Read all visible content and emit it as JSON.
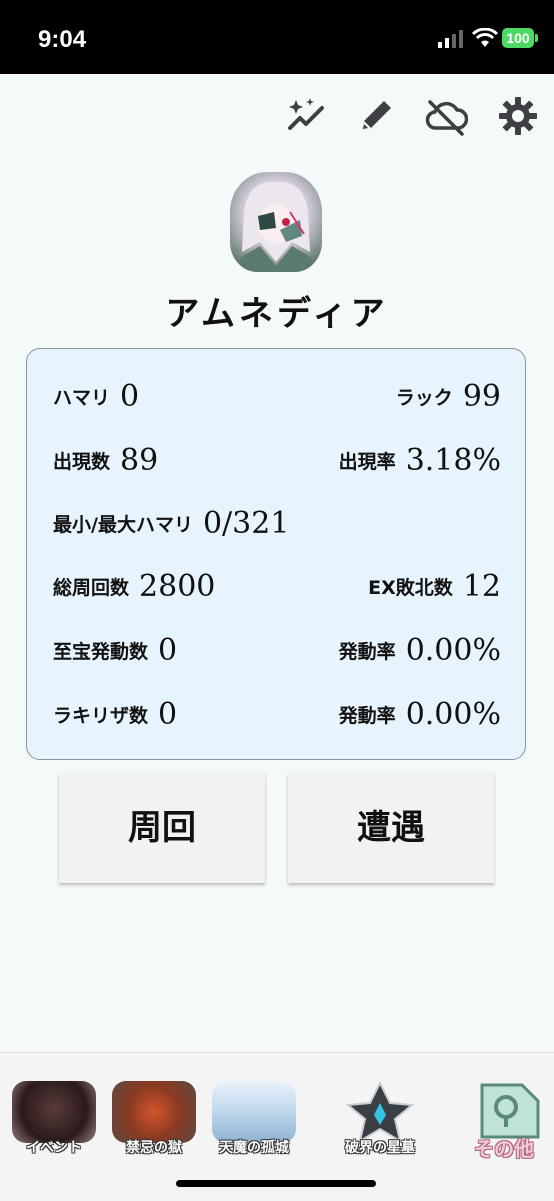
{
  "status_bar": {
    "time": "9:04",
    "battery": "100"
  },
  "toolbar": {
    "icons": [
      "sparkle-trend-icon",
      "pencil-icon",
      "cloud-off-icon",
      "gear-icon"
    ]
  },
  "character": {
    "name": "アムネディア"
  },
  "stats": {
    "hamari_label": "ハマリ",
    "hamari_value": "0",
    "luck_label": "ラック",
    "luck_value": "99",
    "appear_count_label": "出現数",
    "appear_count_value": "89",
    "appear_rate_label": "出現率",
    "appear_rate_value": "3.18%",
    "minmax_label": "最小/最大ハマリ",
    "minmax_value": "0/321",
    "total_laps_label": "総周回数",
    "total_laps_value": "2800",
    "ex_defeat_label": "EX敗北数",
    "ex_defeat_value": "12",
    "treasure_label": "至宝発動数",
    "treasure_value": "0",
    "treasure_rate_label": "発動率",
    "treasure_rate_value": "0.00%",
    "lucky_label": "ラキリザ数",
    "lucky_value": "0",
    "lucky_rate_label": "発動率",
    "lucky_rate_value": "0.00%"
  },
  "actions": {
    "lap_label": "周回",
    "encounter_label": "遭遇"
  },
  "bottom_nav": {
    "items": [
      {
        "label": "イベント"
      },
      {
        "label": "禁忌の獄"
      },
      {
        "label": "天魔の孤城"
      },
      {
        "label": "破界の星墓"
      },
      {
        "label": "その他"
      }
    ]
  }
}
